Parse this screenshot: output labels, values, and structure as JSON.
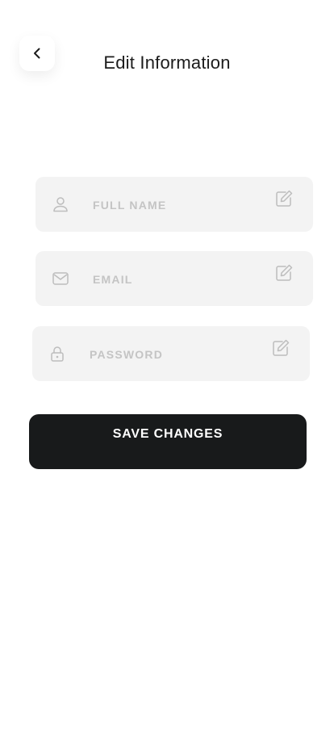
{
  "header": {
    "title": "Edit Information",
    "back_icon": "chevron-left-icon"
  },
  "form": {
    "fields": [
      {
        "placeholder": "FULL NAME",
        "value": "",
        "icon": "user-icon",
        "action_icon": "edit-icon"
      },
      {
        "placeholder": "EMAIL",
        "value": "",
        "icon": "mail-icon",
        "action_icon": "edit-icon"
      },
      {
        "placeholder": "PASSWORD",
        "value": "",
        "icon": "lock-icon",
        "action_icon": "edit-icon"
      }
    ],
    "save_label": "SAVE CHANGES"
  },
  "colors": {
    "button_bg": "#181a1b",
    "field_bg": "#f3f3f3",
    "placeholder": "#c4c4c4",
    "icon": "#bdbdbd"
  }
}
